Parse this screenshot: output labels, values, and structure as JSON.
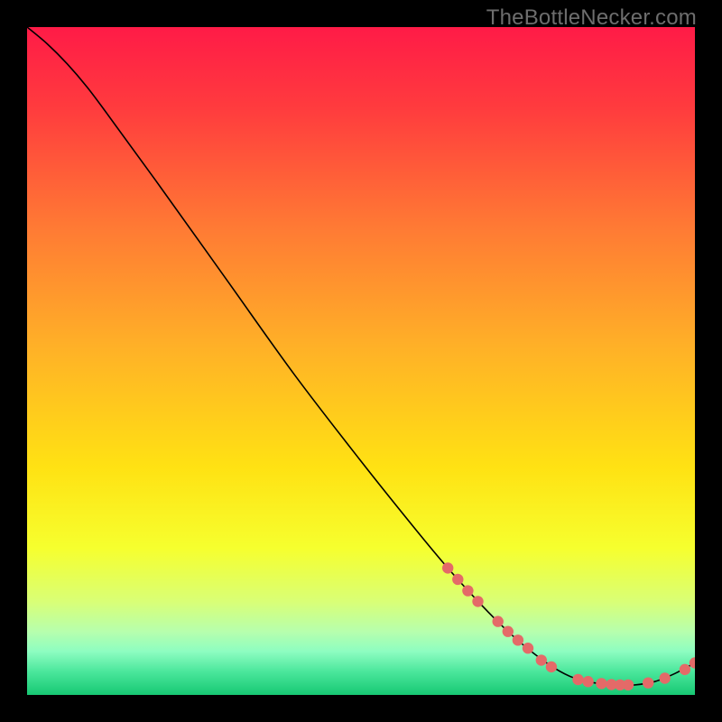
{
  "watermark": "TheBottleNecker.com",
  "chart_data": {
    "type": "line",
    "title": "",
    "xlabel": "",
    "ylabel": "",
    "xlim": [
      0,
      100
    ],
    "ylim": [
      0,
      100
    ],
    "grid": false,
    "legend": false,
    "background_gradient": {
      "stops": [
        {
          "offset": 0.0,
          "color": "#ff1b47"
        },
        {
          "offset": 0.12,
          "color": "#ff3b3e"
        },
        {
          "offset": 0.3,
          "color": "#ff7a34"
        },
        {
          "offset": 0.48,
          "color": "#ffb127"
        },
        {
          "offset": 0.66,
          "color": "#ffe213"
        },
        {
          "offset": 0.78,
          "color": "#f6ff2e"
        },
        {
          "offset": 0.86,
          "color": "#d9ff76"
        },
        {
          "offset": 0.905,
          "color": "#b7ffad"
        },
        {
          "offset": 0.935,
          "color": "#8dfdc1"
        },
        {
          "offset": 0.965,
          "color": "#4be79c"
        },
        {
          "offset": 1.0,
          "color": "#17c873"
        }
      ]
    },
    "series": [
      {
        "name": "bottleneck-curve",
        "stroke": "#000000",
        "stroke_width": 1.6,
        "points": [
          {
            "x": 0.0,
            "y": 100.0
          },
          {
            "x": 3.0,
            "y": 97.5
          },
          {
            "x": 6.0,
            "y": 94.5
          },
          {
            "x": 9.0,
            "y": 91.0
          },
          {
            "x": 12.0,
            "y": 87.0
          },
          {
            "x": 20.0,
            "y": 76.0
          },
          {
            "x": 30.0,
            "y": 62.0
          },
          {
            "x": 40.0,
            "y": 48.0
          },
          {
            "x": 50.0,
            "y": 35.0
          },
          {
            "x": 58.0,
            "y": 25.0
          },
          {
            "x": 63.0,
            "y": 19.0
          },
          {
            "x": 68.0,
            "y": 13.5
          },
          {
            "x": 72.0,
            "y": 9.5
          },
          {
            "x": 75.5,
            "y": 6.5
          },
          {
            "x": 79.0,
            "y": 4.0
          },
          {
            "x": 82.0,
            "y": 2.5
          },
          {
            "x": 85.0,
            "y": 1.8
          },
          {
            "x": 88.0,
            "y": 1.5
          },
          {
            "x": 91.0,
            "y": 1.5
          },
          {
            "x": 94.0,
            "y": 2.0
          },
          {
            "x": 97.0,
            "y": 3.2
          },
          {
            "x": 100.0,
            "y": 4.8
          }
        ]
      }
    ],
    "markers": {
      "color": "#e46a68",
      "radius": 6.2,
      "points": [
        {
          "x": 63.0,
          "y": 19.0
        },
        {
          "x": 64.5,
          "y": 17.3
        },
        {
          "x": 66.0,
          "y": 15.6
        },
        {
          "x": 67.5,
          "y": 14.0
        },
        {
          "x": 70.5,
          "y": 11.0
        },
        {
          "x": 72.0,
          "y": 9.5
        },
        {
          "x": 73.5,
          "y": 8.2
        },
        {
          "x": 75.0,
          "y": 7.0
        },
        {
          "x": 77.0,
          "y": 5.2
        },
        {
          "x": 78.5,
          "y": 4.2
        },
        {
          "x": 82.5,
          "y": 2.3
        },
        {
          "x": 84.0,
          "y": 2.0
        },
        {
          "x": 86.0,
          "y": 1.7
        },
        {
          "x": 87.5,
          "y": 1.55
        },
        {
          "x": 88.8,
          "y": 1.5
        },
        {
          "x": 90.0,
          "y": 1.5
        },
        {
          "x": 93.0,
          "y": 1.8
        },
        {
          "x": 95.5,
          "y": 2.5
        },
        {
          "x": 98.5,
          "y": 3.8
        },
        {
          "x": 100.0,
          "y": 4.8
        }
      ]
    }
  }
}
